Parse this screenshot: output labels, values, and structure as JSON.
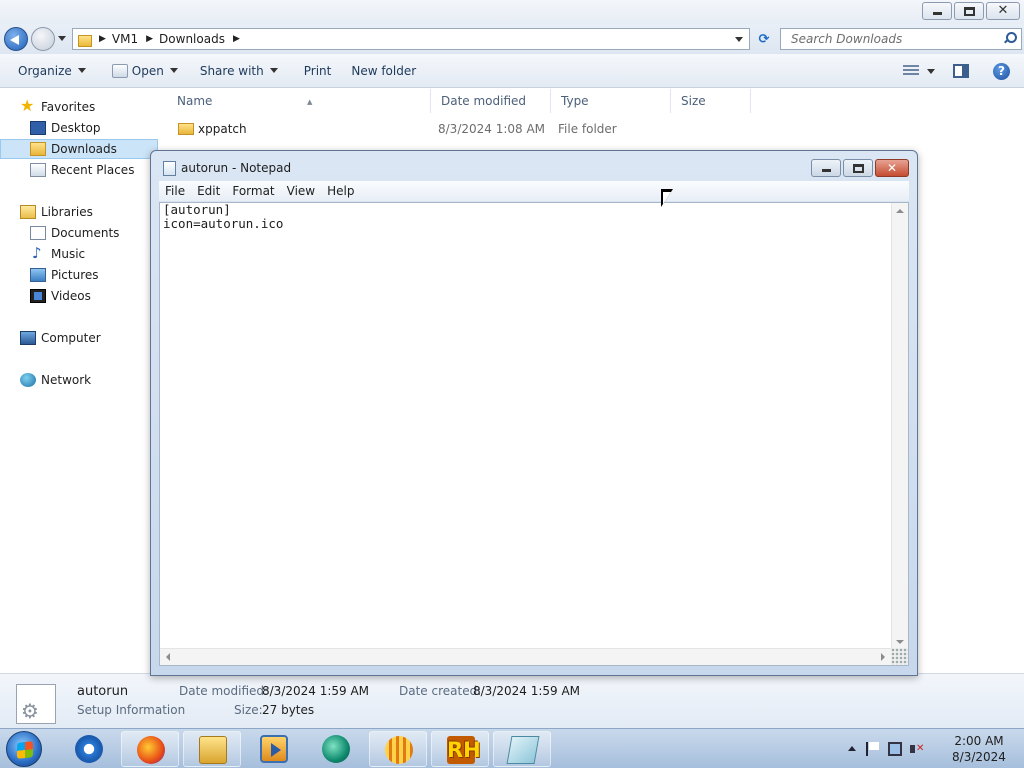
{
  "explorer": {
    "breadcrumb": [
      "VM1",
      "Downloads"
    ],
    "search_placeholder": "Search Downloads",
    "toolbar": {
      "organize": "Organize",
      "open": "Open",
      "share_with": "Share with",
      "print": "Print",
      "new_folder": "New folder"
    },
    "nav": {
      "favorites": "Favorites",
      "desktop": "Desktop",
      "downloads": "Downloads",
      "recent_places": "Recent Places",
      "libraries": "Libraries",
      "documents": "Documents",
      "music": "Music",
      "pictures": "Pictures",
      "videos": "Videos",
      "computer": "Computer",
      "network": "Network"
    },
    "columns": {
      "name": "Name",
      "date_modified": "Date modified",
      "type": "Type",
      "size": "Size"
    },
    "files": [
      {
        "name": "xppatch",
        "date": "8/3/2024 1:08 AM",
        "type": "File folder",
        "size": ""
      }
    ],
    "details": {
      "name": "autorun",
      "type": "Setup Information",
      "date_modified_label": "Date modified:",
      "date_modified": "8/3/2024 1:59 AM",
      "date_created_label": "Date created:",
      "date_created": "8/3/2024 1:59 AM",
      "size_label": "Size:",
      "size": "27 bytes"
    }
  },
  "notepad": {
    "title": "autorun - Notepad",
    "menu": [
      "File",
      "Edit",
      "Format",
      "View",
      "Help"
    ],
    "content": "[autorun]\nicon=autorun.ico"
  },
  "taskbar": {
    "apps": [
      "internet-explorer",
      "firefox",
      "windows-explorer",
      "media-player",
      "green-app",
      "orange-app",
      "rh-app",
      "notepad"
    ],
    "clock_time": "2:00 AM",
    "clock_date": "8/3/2024"
  }
}
